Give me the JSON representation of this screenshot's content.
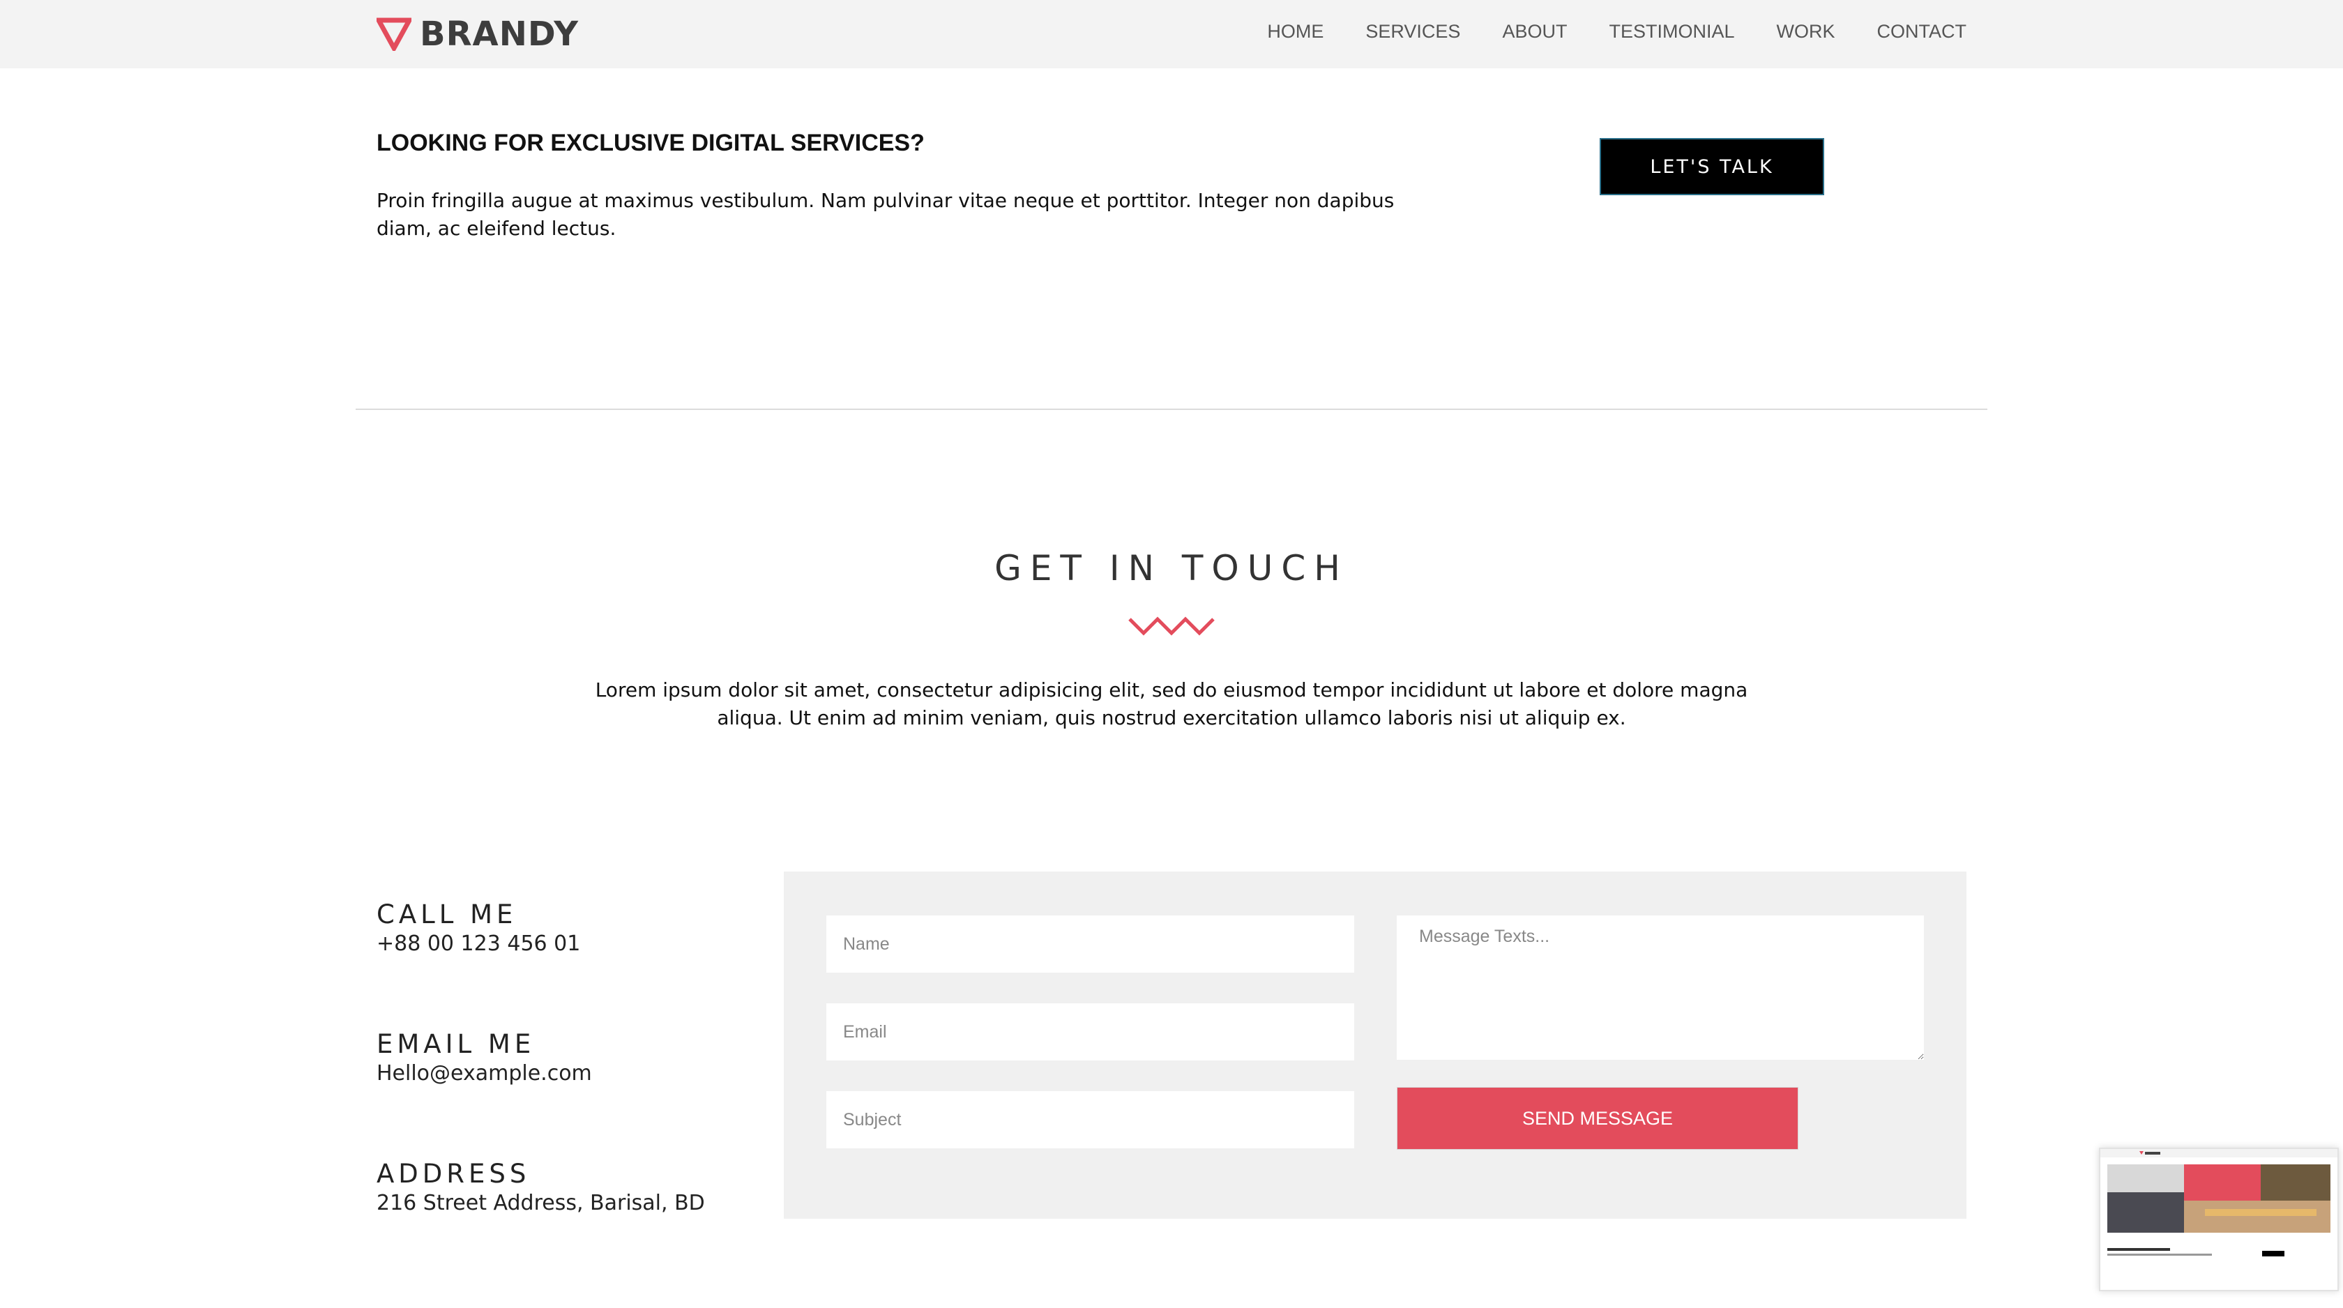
{
  "brand": {
    "name": "BRANDY",
    "accent_color": "#e34c5c"
  },
  "nav": {
    "items": [
      "HOME",
      "SERVICES",
      "ABOUT",
      "TESTIMONIAL",
      "WORK",
      "CONTACT"
    ]
  },
  "promo": {
    "title": "LOOKING FOR EXCLUSIVE DIGITAL SERVICES?",
    "text": "Proin fringilla augue at maximus vestibulum. Nam pulvinar vitae neque et porttitor. Integer non dapibus diam, ac eleifend lectus.",
    "button": "LET'S TALK"
  },
  "contact": {
    "title": "GET IN TOUCH",
    "intro": "Lorem ipsum dolor sit amet, consectetur adipisicing elit, sed do eiusmod tempor incididunt ut labore et dolore magna aliqua. Ut enim ad minim veniam, quis nostrud exercitation ullamco laboris nisi ut aliquip ex.",
    "info": [
      {
        "label": "CALL ME",
        "value": "+88 00 123 456 01"
      },
      {
        "label": "EMAIL ME",
        "value": "Hello@example.com"
      },
      {
        "label": "ADDRESS",
        "value": "216 Street Address, Barisal, BD"
      }
    ],
    "form": {
      "name_placeholder": "Name",
      "email_placeholder": "Email",
      "subject_placeholder": "Subject",
      "message_placeholder": "Message Texts...",
      "send_label": "SEND MESSAGE"
    }
  }
}
